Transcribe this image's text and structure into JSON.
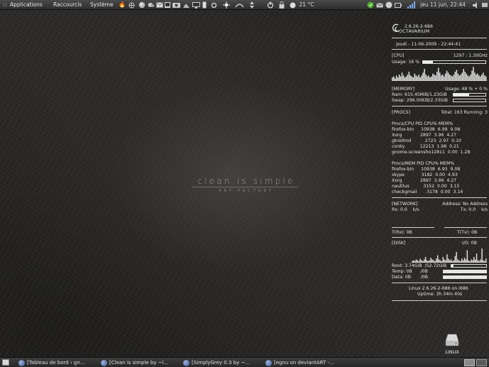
{
  "top_panel": {
    "menus": [
      "Applications",
      "Raccourcis",
      "Système"
    ],
    "temperature": "21 °C",
    "clock": "jeu 11 jun, 22:44"
  },
  "wallpaper": {
    "title": "clean is simple",
    "subtitle": "ART FACTORY"
  },
  "conky": {
    "kernel_short": "2.6.26-2-686",
    "hostname": "OCTAVARIUM",
    "datetime": "jeudi - 11-06-2009 - 22:44:41",
    "cpu": {
      "label": "[CPU]",
      "freq": "1297 : 1.30GHz",
      "usage_label": "Usage: 16 %",
      "usage_fraction": 0.16,
      "history": [
        3,
        4,
        2,
        5,
        3,
        6,
        4,
        8,
        5,
        3,
        4,
        6,
        9,
        5,
        4,
        3,
        7,
        5,
        4,
        6,
        3,
        5,
        8,
        12,
        6,
        4,
        5,
        3,
        4,
        7,
        6,
        5,
        9,
        13,
        8,
        5,
        6,
        4,
        7,
        10,
        8,
        6,
        5,
        4,
        6,
        9,
        11,
        7,
        5,
        6,
        8,
        12,
        9,
        7,
        5,
        4,
        6,
        10,
        14,
        8,
        6,
        7,
        5,
        4,
        6,
        8,
        5,
        4
      ]
    },
    "memory": {
      "label": "[MEMORY]",
      "usage": "Usage: 48 % + 0  %",
      "ram": "Ram: 615.45MiB/1.23GiB",
      "ram_fraction": 0.48,
      "swap": "Swap: 296.00KiB/2.33GiB",
      "swap_fraction": 0.0
    },
    "procs": {
      "label": "[PROCS]",
      "summary": "Total: 163  Running: 3",
      "cpu_header": "Procs/CPU PID CPU% MEM%",
      "cpu_rows": [
        "firefox-bin     10938  6.99  9.08",
        "Xorg             2897  3.96  4.27",
        "gkrellmd          2723  2.97  0.10",
        "conky           12213  1.98  0.21",
        "gnome-screensho12811  0.00  1.28"
      ],
      "mem_header": "Procs/MEM PID CPU% MEM%",
      "mem_rows": [
        "firefox-bin     10938  6.93  9.08",
        "skype            3182  0.00  4.93",
        "Xorg             2897  3.96  4.27",
        "nautilus          3152  0.00  3.15",
        "checkgmail       3178  0.00  3.14"
      ]
    },
    "network": {
      "label": "[NETWORK]",
      "address": "Address: No Address",
      "rx": "Rx: 0.0    k/s",
      "tx": "Tx: 0.0    k/s",
      "trx": "T(Rx): 0B",
      "ttx": "T(Tx): 0B"
    },
    "disk": {
      "label": "[DISK]",
      "io": "I/O: 0B",
      "history": [
        1,
        2,
        1,
        3,
        2,
        1,
        4,
        2,
        1,
        3,
        6,
        2,
        1,
        2,
        5,
        3,
        2,
        1,
        4,
        8,
        3,
        2,
        1,
        6,
        3,
        2,
        9,
        4,
        2,
        3,
        1,
        2,
        7,
        12,
        3,
        2,
        1,
        4,
        2,
        5,
        3,
        14,
        2,
        1,
        3,
        2,
        6,
        3,
        10,
        2,
        1,
        3,
        16,
        2,
        1,
        4
      ],
      "root": "Root: 3.74GiB  /52.72GiB",
      "root_fraction": 0.07,
      "temp": "Temp: 0B      /0B",
      "data": "Data: 0B       /0B"
    },
    "kernel": "Linux 2.6.26-2-686 on i686",
    "uptime": "Uptime: 3h 34m 40s"
  },
  "desktop_icons": [
    {
      "label": "LINUX",
      "icon": "drive-icon"
    }
  ],
  "taskbar": {
    "tasks": [
      "[Tableau de bord ‹ gn…",
      "[Clean is simple by ~i…",
      "[SimplyGrey 0.3 by ~…",
      "[egnu on deviantART -…"
    ]
  },
  "colors": {
    "accent_green": "#4caf2a",
    "panel": "#3a3a3a",
    "text": "#e6e6e6"
  }
}
